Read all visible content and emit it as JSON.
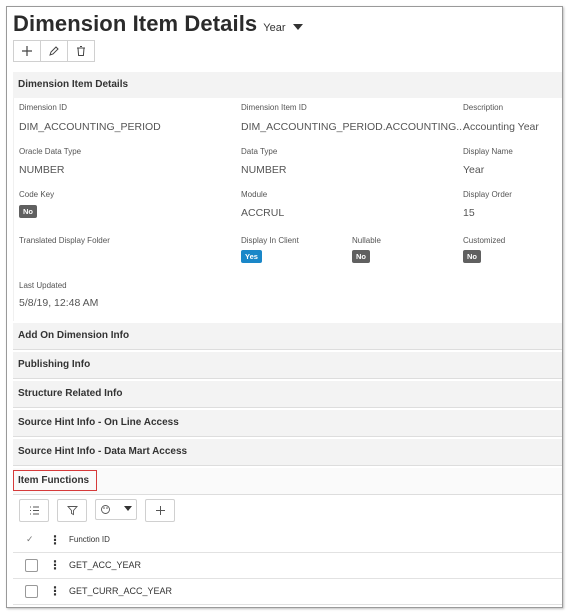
{
  "header": {
    "title": "Dimension Item Details",
    "selector_value": "Year"
  },
  "toolbar": {
    "buttons": [
      "add-icon",
      "edit-icon",
      "delete-icon"
    ]
  },
  "details": {
    "section_title": "Dimension Item Details",
    "fields": {
      "dimension_id": {
        "label": "Dimension ID",
        "value": "DIM_ACCOUNTING_PERIOD"
      },
      "dimension_item_id": {
        "label": "Dimension Item ID",
        "value": "DIM_ACCOUNTING_PERIOD.ACCOUNTING..."
      },
      "description": {
        "label": "Description",
        "value": "Accounting Year"
      },
      "oracle_data_type": {
        "label": "Oracle Data Type",
        "value": "NUMBER"
      },
      "data_type": {
        "label": "Data Type",
        "value": "NUMBER"
      },
      "display_name": {
        "label": "Display Name",
        "value": "Year"
      },
      "code_key": {
        "label": "Code Key",
        "value": "No"
      },
      "module": {
        "label": "Module",
        "value": "ACCRUL"
      },
      "display_order": {
        "label": "Display Order",
        "value": "15"
      },
      "translated_display_folder": {
        "label": "Translated Display Folder",
        "value": ""
      },
      "display_in_client": {
        "label": "Display In Client",
        "value": "Yes"
      },
      "nullable": {
        "label": "Nullable",
        "value": "No"
      },
      "customized": {
        "label": "Customized",
        "value": "No"
      },
      "last_updated": {
        "label": "Last Updated",
        "value": "5/8/19, 12:48 AM"
      }
    }
  },
  "sections": [
    "Add On Dimension Info",
    "Publishing Info",
    "Structure Related Info",
    "Source Hint Info - On Line Access",
    "Source Hint Info - Data Mart Access",
    "Item Functions"
  ],
  "grid": {
    "columns": [
      "Function ID"
    ],
    "rows": [
      "GET_ACC_YEAR",
      "GET_CURR_ACC_YEAR"
    ]
  },
  "colors": {
    "yes_badge": "#1a87c8",
    "no_badge": "#606060",
    "highlight": "#d63a3a",
    "section_bg": "#f3f3f3"
  }
}
